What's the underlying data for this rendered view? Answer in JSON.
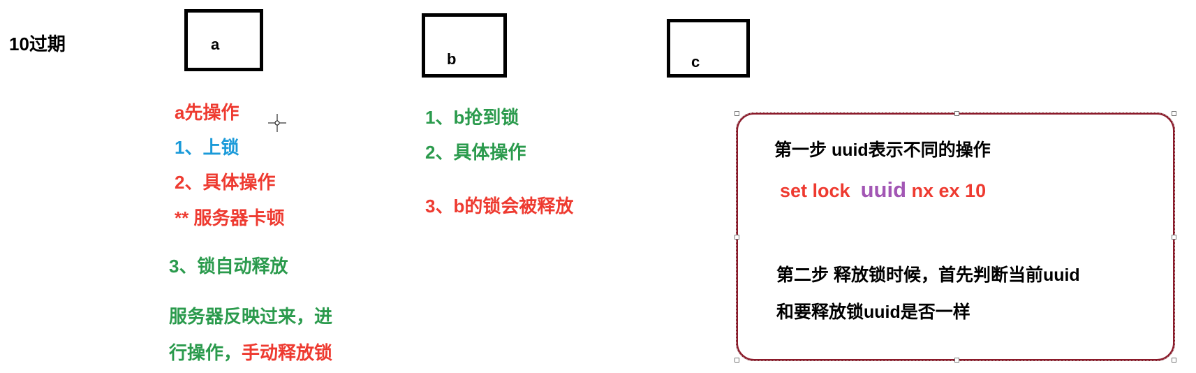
{
  "title": "10过期",
  "boxes": {
    "a": "a",
    "b": "b",
    "c": "c"
  },
  "column_a": {
    "heading": "a先操作",
    "step1": "1、上锁",
    "step2": "2、具体操作",
    "note": "** 服务器卡顿",
    "step3": "3、锁自动释放",
    "line1": "服务器反映过来，进",
    "line2_green": "行操作，",
    "line2_red": "手动释放锁"
  },
  "column_b": {
    "step1": "1、b抢到锁",
    "step2": "2、具体操作",
    "step3": "3、b的锁会被释放"
  },
  "note_box": {
    "step1_title": "第一步 uuid表示不同的操作",
    "cmd_prefix": "set lock",
    "cmd_uuid": "uuid",
    "cmd_suffix": "nx ex 10",
    "step2_line1": "第二步 释放锁时候，首先判断当前uuid",
    "step2_line2": "和要释放锁uuid是否一样"
  },
  "colors": {
    "red": "#ee3a30",
    "blue": "#1a9ad9",
    "green": "#2a9a4c",
    "purple": "#a256b4",
    "border": "#8b1a2a"
  }
}
